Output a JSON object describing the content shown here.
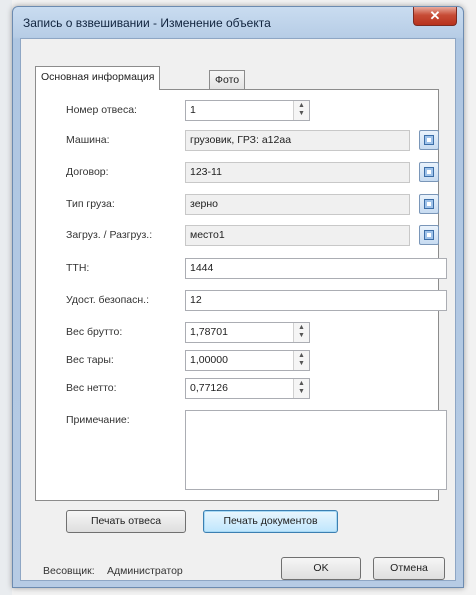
{
  "window": {
    "title": "Запись о взвешивании - Изменение объекта",
    "close_glyph": "✕"
  },
  "tabs": [
    {
      "label": "Основная информация",
      "active": true
    },
    {
      "label": "Фото",
      "active": false
    }
  ],
  "form": {
    "weighing_no": {
      "label": "Номер отвеса:",
      "value": "1"
    },
    "vehicle": {
      "label": "Машина:",
      "value": "грузовик, ГРЗ: а12аа"
    },
    "contract": {
      "label": "Договор:",
      "value": "123-11"
    },
    "cargo_type": {
      "label": "Тип груза:",
      "value": "зерно"
    },
    "load_unload": {
      "label": "Загруз. / Разгруз.:",
      "value": "место1"
    },
    "ttn": {
      "label": "ТТН:",
      "value": "1444"
    },
    "security_id": {
      "label": "Удост. безопасн.:",
      "value": "12"
    },
    "gross": {
      "label": "Вес брутто:",
      "value": "1,78701"
    },
    "tare": {
      "label": "Вес тары:",
      "value": "1,00000"
    },
    "net": {
      "label": "Вес нетто:",
      "value": "0,77126"
    },
    "note": {
      "label": "Примечание:",
      "value": ""
    }
  },
  "buttons": {
    "print_weighing": "Печать отвеса",
    "print_documents": "Печать документов",
    "ok": "OK",
    "cancel": "Отмена"
  },
  "footer": {
    "weigher_label": "Весовщик:",
    "weigher_value": "Администратор"
  },
  "icons": {
    "spin_up": "▲",
    "spin_down": "▼",
    "browse": "ellipsis-browse-icon"
  },
  "colors": {
    "title_bar": "#b7cde6",
    "close": "#c74c36",
    "focus_button": "#bee6fd"
  }
}
